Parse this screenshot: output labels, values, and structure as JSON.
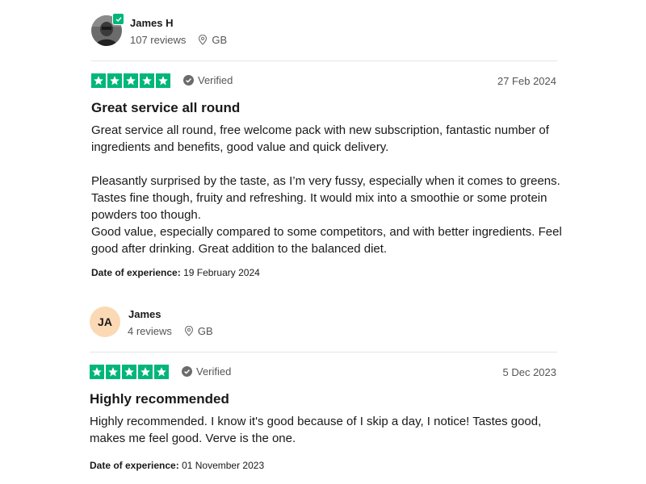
{
  "reviews": [
    {
      "user": {
        "name": "James H",
        "reviews": "107 reviews",
        "country": "GB",
        "initials": ""
      },
      "rating": 5,
      "verified_label": "Verified",
      "date": "27 Feb 2024",
      "title": "Great service all round",
      "paragraphs": [
        "Great service all round, free welcome pack with new subscription, fantastic number of ingredients and benefits, good value and quick delivery.",
        "",
        "Pleasantly surprised by the taste, as I’m very fussy, especially when it comes to greens. Tastes fine though, fruity and refreshing. It would mix into a smoothie or some protein powders too though.",
        "Good value, especially compared to some competitors, and with better ingredients. Feel good after drinking. Great addition to the balanced diet."
      ],
      "experience_label": "Date of experience:",
      "experience_date": "19 February 2024"
    },
    {
      "user": {
        "name": "James",
        "reviews": "4 reviews",
        "country": "GB",
        "initials": "JA"
      },
      "rating": 5,
      "verified_label": "Verified",
      "date": "5 Dec 2023",
      "title": "Highly recommended",
      "paragraphs": [
        "Highly recommended. I know it's good because of I skip a day, I notice! Tastes good, makes me feel good. Verve is the one."
      ],
      "experience_label": "Date of experience:",
      "experience_date": "01 November 2023"
    }
  ],
  "colors": {
    "star_green": "#00b67a",
    "initials_bg": "#fbd9b4",
    "muted_text": "#555555"
  },
  "icons": [
    "verified-check-icon",
    "location-pin-icon",
    "star-icon",
    "user-photo"
  ]
}
